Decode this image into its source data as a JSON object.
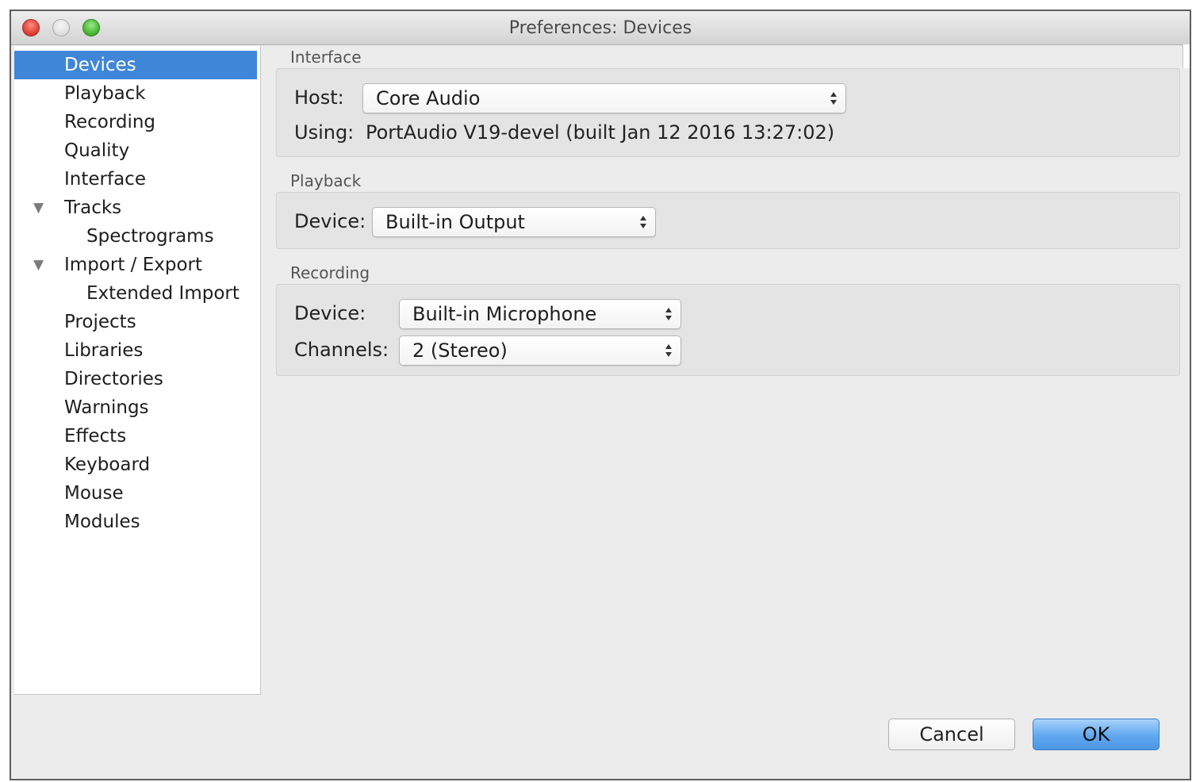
{
  "window": {
    "title": "Preferences: Devices"
  },
  "sidebar": {
    "items": [
      {
        "label": "Devices",
        "selected": true
      },
      {
        "label": "Playback"
      },
      {
        "label": "Recording"
      },
      {
        "label": "Quality"
      },
      {
        "label": "Interface"
      },
      {
        "label": "Tracks",
        "expanded": true
      },
      {
        "label": "Spectrograms",
        "child": true
      },
      {
        "label": "Import / Export",
        "expanded": true
      },
      {
        "label": "Extended Import",
        "child": true
      },
      {
        "label": "Projects"
      },
      {
        "label": "Libraries"
      },
      {
        "label": "Directories"
      },
      {
        "label": "Warnings"
      },
      {
        "label": "Effects"
      },
      {
        "label": "Keyboard"
      },
      {
        "label": "Mouse"
      },
      {
        "label": "Modules"
      }
    ],
    "disclosure_glyph": "▼"
  },
  "interface": {
    "group_label": "Interface",
    "host_label": "Host:",
    "host_value": "Core Audio",
    "using_label": "Using:",
    "using_value": "PortAudio V19-devel (built Jan 12 2016 13:27:02)"
  },
  "playback": {
    "group_label": "Playback",
    "device_label": "Device:",
    "device_value": "Built-in Output"
  },
  "recording": {
    "group_label": "Recording",
    "device_label": "Device:",
    "device_value": "Built-in Microphone",
    "channels_label": "Channels:",
    "channels_value": "2 (Stereo)"
  },
  "buttons": {
    "cancel": "Cancel",
    "ok": "OK"
  },
  "colors": {
    "selection": "#3f86d9",
    "ok_button": "#5fa7ee",
    "close_button": "#e0443a",
    "zoom_button": "#4cbb37"
  }
}
